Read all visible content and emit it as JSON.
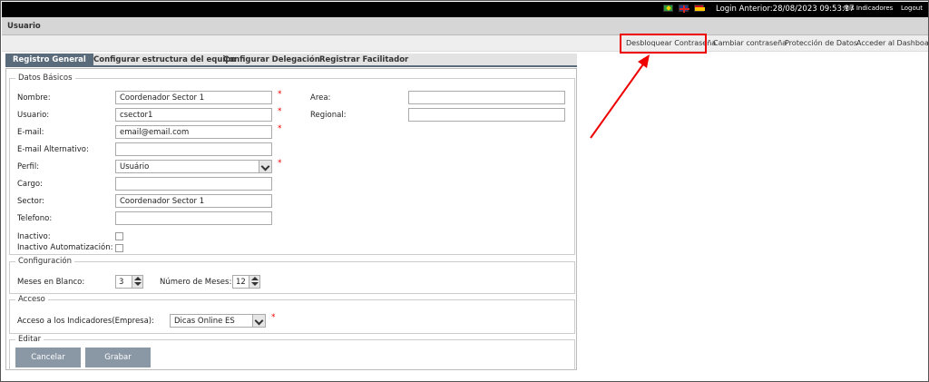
{
  "topbar": {
    "login_text": "Login Anterior:28/08/2023 09:53:17",
    "mis_indicadores": "Mis Indicadores",
    "logout": "Logout"
  },
  "titlebar": {
    "title": "Usuario"
  },
  "actions": {
    "desbloquear": "Desbloquear Contraseña",
    "cambiar": "Cambiar contraseña",
    "proteccion": "Protección de Datos",
    "dashboard": "Acceder al Dashboard"
  },
  "tabs": [
    "Registro General",
    "Configurar estructura del equipo",
    "Configurar Delegación",
    "Registrar Facilitador"
  ],
  "datos": {
    "legend": "Datos Básicos",
    "nombre_label": "Nombre:",
    "nombre_value": "Coordenador Sector 1",
    "usuario_label": "Usuario:",
    "usuario_value": "csector1",
    "email_label": "E-mail:",
    "email_value": "email@email.com",
    "email_alt_label": "E-mail Alternativo:",
    "perfil_label": "Perfil:",
    "perfil_value": "Usuário",
    "cargo_label": "Cargo:",
    "sector_label": "Sector:",
    "sector_value": "Coordenador Sector 1",
    "telefono_label": "Telefono:",
    "inactivo_label": "Inactivo:",
    "inactivo_auto_label": "Inactivo Automatización:",
    "area_label": "Area:",
    "regional_label": "Regional:",
    "required_mark": "*"
  },
  "configuracion": {
    "legend": "Configuración",
    "meses_label": "Meses en Blanco:",
    "meses_value": "3",
    "numero_label": "Número de Meses:",
    "numero_value": "12"
  },
  "acceso": {
    "legend": "Acceso",
    "label": "Acceso a los Indicadores(Empresa):",
    "value": "Dicas Online ES"
  },
  "editar": {
    "legend": "Editar",
    "cancelar": "Cancelar",
    "grabar": "Grabar"
  },
  "colors": {
    "highlight": "#e00000",
    "tab_active": "#5a6b7b",
    "button": "#8a97a5"
  }
}
